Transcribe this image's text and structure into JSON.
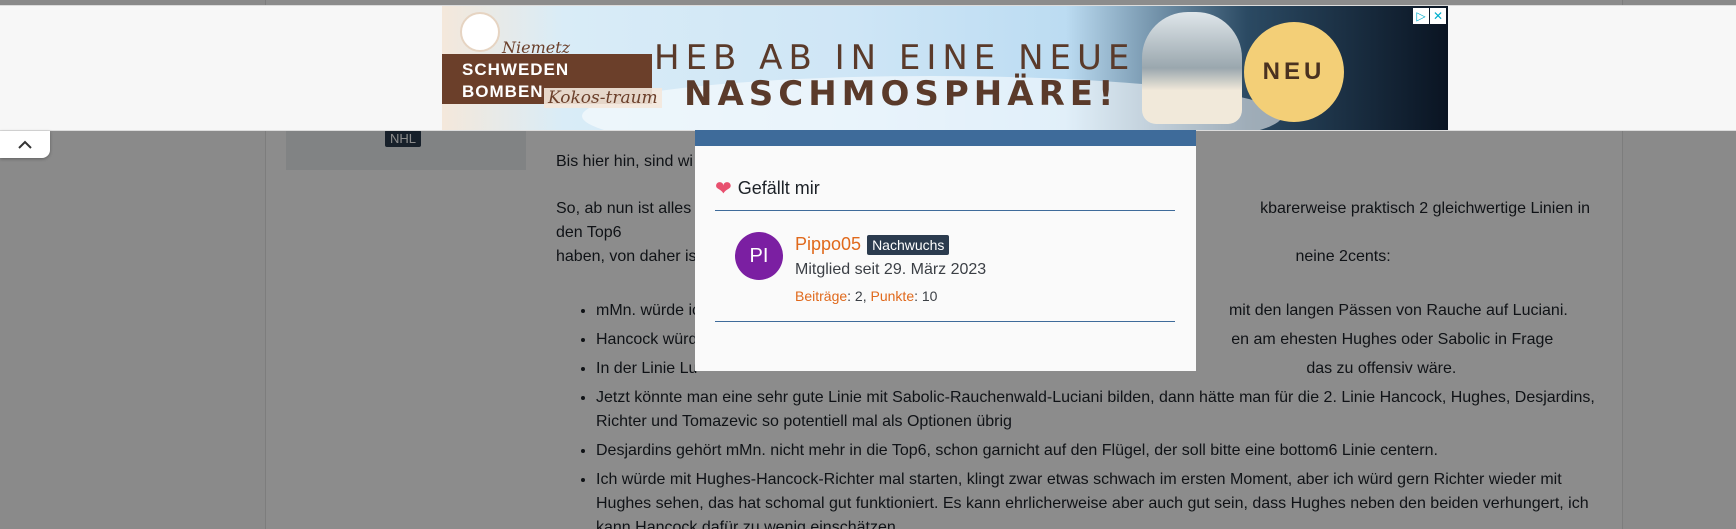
{
  "ad": {
    "brand_line_1": "SCHWEDEN",
    "brand_line_2": "BOMBEN",
    "brand_script_1": "Niemetz",
    "brand_script_2": "Kokos-traum",
    "headline_1": "HEB AB IN EINE NEUE",
    "headline_2": "NASCHMOSPHÄRE!",
    "badge": "NEU",
    "adchoices_icon": "▷",
    "close_icon": "✕"
  },
  "sidebar": {
    "user_tag": "NHL"
  },
  "post": {
    "p1": "Bis hier hin, sind wi",
    "p2_start": "So, ab nun ist alles",
    "p2_end": "kbarerweise praktisch 2 gleichwertige Linien in den Top6",
    "p3_start": "haben, von daher is",
    "p3_end": "neine 2cents:",
    "items": [
      {
        "start": "mMn. würde ic",
        "end": "mit den langen Pässen von Rauche auf Luciani."
      },
      {
        "start": "Hancock würd",
        "end": "en am ehesten Hughes oder Sabolic in Frage"
      },
      {
        "start": "In der Linie Lu",
        "end": "das zu offensiv wäre."
      },
      {
        "text": "Jetzt könnte man eine sehr gute Linie mit Sabolic-Rauchenwald-Luciani bilden, dann hätte man für die 2. Linie Hancock, Hughes, Desjardins, Richter und Tomazevic so potentiell mal als Optionen übrig"
      },
      {
        "text": "Desjardins gehört mMn. nicht mehr in die Top6, schon garnicht auf den Flügel, der soll bitte eine bottom6 Linie centern."
      },
      {
        "text": "Ich würde mit Hughes-Hancock-Richter mal starten, klingt zwar etwas schwach im ersten Moment, aber ich würd gern Richter wieder mit Hughes sehen, das hat schomal gut funktioniert. Es kann ehrlicherweise aber auch gut sein, dass Hughes neben den beiden verhungert, ich kann Hancock dafür zu wenig einschätzen."
      }
    ]
  },
  "modal": {
    "heart_icon": "❤",
    "title": "Gefällt mir",
    "user": {
      "avatar_initials": "PI",
      "avatar_color": "#7b1fa2",
      "name": "Pippo05",
      "role": "Nachwuchs",
      "member_since": "Mitglied seit 29. März 2023",
      "posts_label": "Beiträge",
      "posts_value": ": 2,",
      "points_label": "Punkte",
      "points_value": ": 10"
    }
  },
  "collapse_icon": "chevron-up-icon"
}
